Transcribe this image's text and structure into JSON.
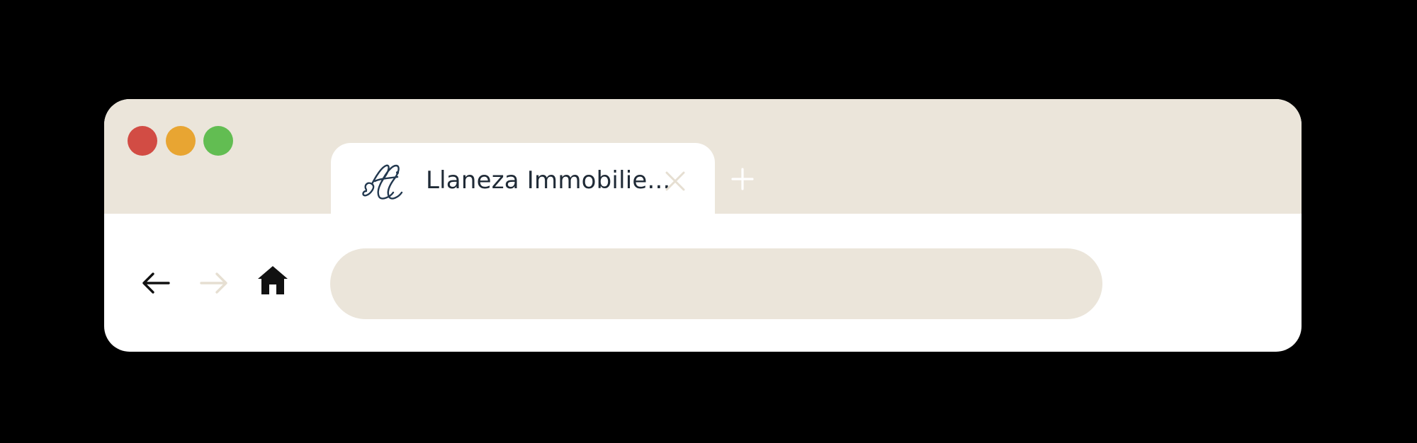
{
  "colors": {
    "background": "#000000",
    "chrome": "#ebe5da",
    "traffic_red": "#d24c44",
    "traffic_yellow": "#e8a532",
    "traffic_green": "#62bd52",
    "icon_dark": "#111111",
    "icon_disabled": "#e6dfd2",
    "text": "#1f2a36"
  },
  "window_controls": [
    {
      "name": "close",
      "color": "#d24c44"
    },
    {
      "name": "minimize",
      "color": "#e8a532"
    },
    {
      "name": "maximize",
      "color": "#62bd52"
    }
  ],
  "tabs": [
    {
      "title": "Llaneza Immobilie...",
      "favicon": "ll-monogram-icon",
      "active": true
    }
  ],
  "toolbar": {
    "back": {
      "icon": "arrow-left-icon",
      "enabled": true
    },
    "forward": {
      "icon": "arrow-right-icon",
      "enabled": false
    },
    "home": {
      "icon": "home-icon"
    },
    "address": {
      "value": ""
    }
  }
}
